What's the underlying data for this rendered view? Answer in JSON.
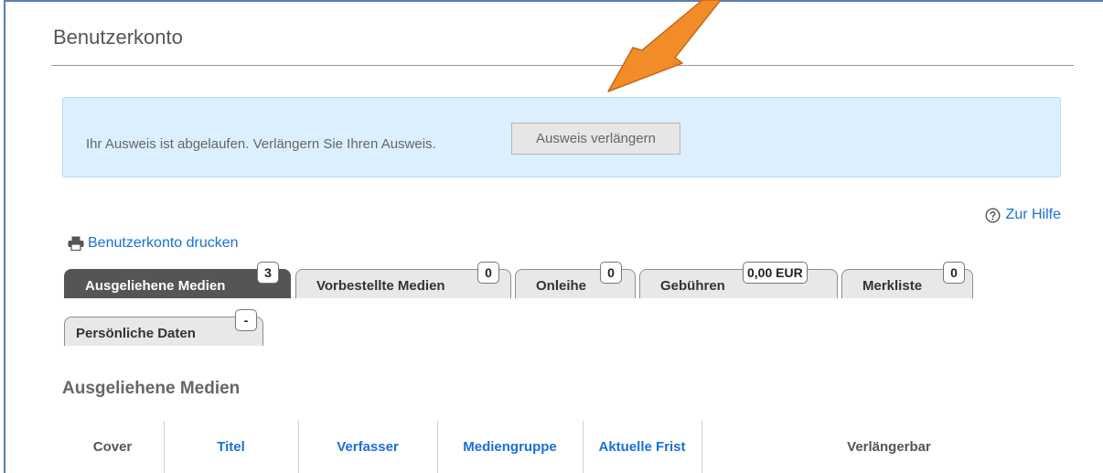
{
  "page": {
    "title": "Benutzerkonto"
  },
  "alert": {
    "message": "Ihr Ausweis ist abgelaufen. Verlängern Sie Ihren Ausweis.",
    "button_label": "Ausweis verlängern"
  },
  "help": {
    "label": "Zur Hilfe",
    "icon": "question-circle-icon"
  },
  "print": {
    "label": "Benutzerkonto drucken",
    "icon": "printer-icon"
  },
  "tabs": [
    {
      "label": "Ausgeliehene Medien",
      "badge": "3",
      "active": true
    },
    {
      "label": "Vorbestellte Medien",
      "badge": "0",
      "active": false
    },
    {
      "label": "Onleihe",
      "badge": "0",
      "active": false
    },
    {
      "label": "Gebühren",
      "badge": "0,00 EUR",
      "active": false
    },
    {
      "label": "Merkliste",
      "badge": "0",
      "active": false
    },
    {
      "label": "Persönliche Daten",
      "badge": "-",
      "active": false
    }
  ],
  "section": {
    "heading": "Ausgeliehene Medien"
  },
  "table": {
    "columns": [
      {
        "label": "Cover",
        "sortable": false
      },
      {
        "label": "Titel",
        "sortable": true
      },
      {
        "label": "Verfasser",
        "sortable": true
      },
      {
        "label": "Mediengruppe",
        "sortable": true
      },
      {
        "label": "Aktuelle Frist",
        "sortable": true
      },
      {
        "label": "Verlängerbar",
        "sortable": false
      }
    ]
  },
  "colors": {
    "link": "#1a70d6",
    "alert_bg": "#dcefff",
    "active_tab": "#555555",
    "annotation_arrow": "#f28c28"
  }
}
